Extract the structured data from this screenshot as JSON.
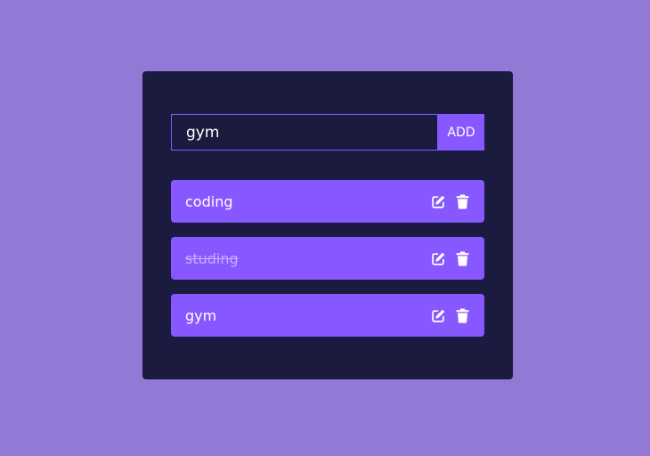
{
  "colors": {
    "background": "#9379d6",
    "card": "#1b1b3f",
    "accent": "#8758ff",
    "text": "#ffffff",
    "completed_text": "#c5aeff"
  },
  "form": {
    "input_value": "gym",
    "add_label": "ADD"
  },
  "todos": [
    {
      "text": "coding",
      "completed": false,
      "edit_icon": "edit-icon",
      "delete_icon": "trash-icon"
    },
    {
      "text": "studing",
      "completed": true,
      "edit_icon": "edit-icon",
      "delete_icon": "trash-icon"
    },
    {
      "text": "gym",
      "completed": false,
      "edit_icon": "edit-icon",
      "delete_icon": "trash-icon"
    }
  ]
}
